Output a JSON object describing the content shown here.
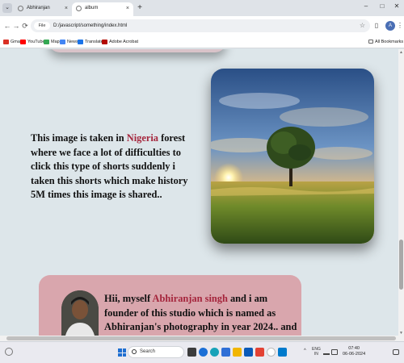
{
  "browser": {
    "tabs": [
      {
        "title": "Abhiranjan",
        "close": "×"
      },
      {
        "title": "album",
        "close": "×"
      }
    ],
    "new_tab": "+",
    "tab_menu": "⌄",
    "window_controls": {
      "minimize": "–",
      "maximize": "□",
      "close": "✕"
    },
    "nav": {
      "back": "←",
      "forward": "→",
      "reload": "⟳"
    },
    "address": {
      "scheme_label": "File",
      "url": "D:/javascript/something/index.html"
    },
    "bookmarks": [
      {
        "label": "Gmail",
        "color": "#d93025"
      },
      {
        "label": "YouTube",
        "color": "#ff0000"
      },
      {
        "label": "Maps",
        "color": "#34a853"
      },
      {
        "label": "News",
        "color": "#4285f4"
      },
      {
        "label": "Translate",
        "color": "#1a73e8"
      },
      {
        "label": "Adobe Acrobat",
        "color": "#b30b00"
      }
    ],
    "all_bookmarks": "All Bookmarks",
    "profile_initial": "A"
  },
  "page": {
    "photo_section": {
      "text_before": "This image is taken in ",
      "highlight": "Nigeria",
      "text_after": " forest where we face a lot of difficulties to click this type of shorts suddenly i taken this shorts which make history 5M times this image is shared..",
      "highlight_color": "#a5253c"
    },
    "about_section": {
      "text_before": "Hii, myself ",
      "highlight": "Abhiranjan singh",
      "text_after": " and i am founder of this studio which is named as Abhiranjan's photography in year 2024.. and i want to thank all of you for your",
      "card_color": "#d9a6ad"
    }
  },
  "taskbar": {
    "search_placeholder": "Search",
    "language": [
      "ENG",
      "IN"
    ],
    "time": "07:40",
    "date": "06-06-2024",
    "tray_chevron": "^"
  }
}
